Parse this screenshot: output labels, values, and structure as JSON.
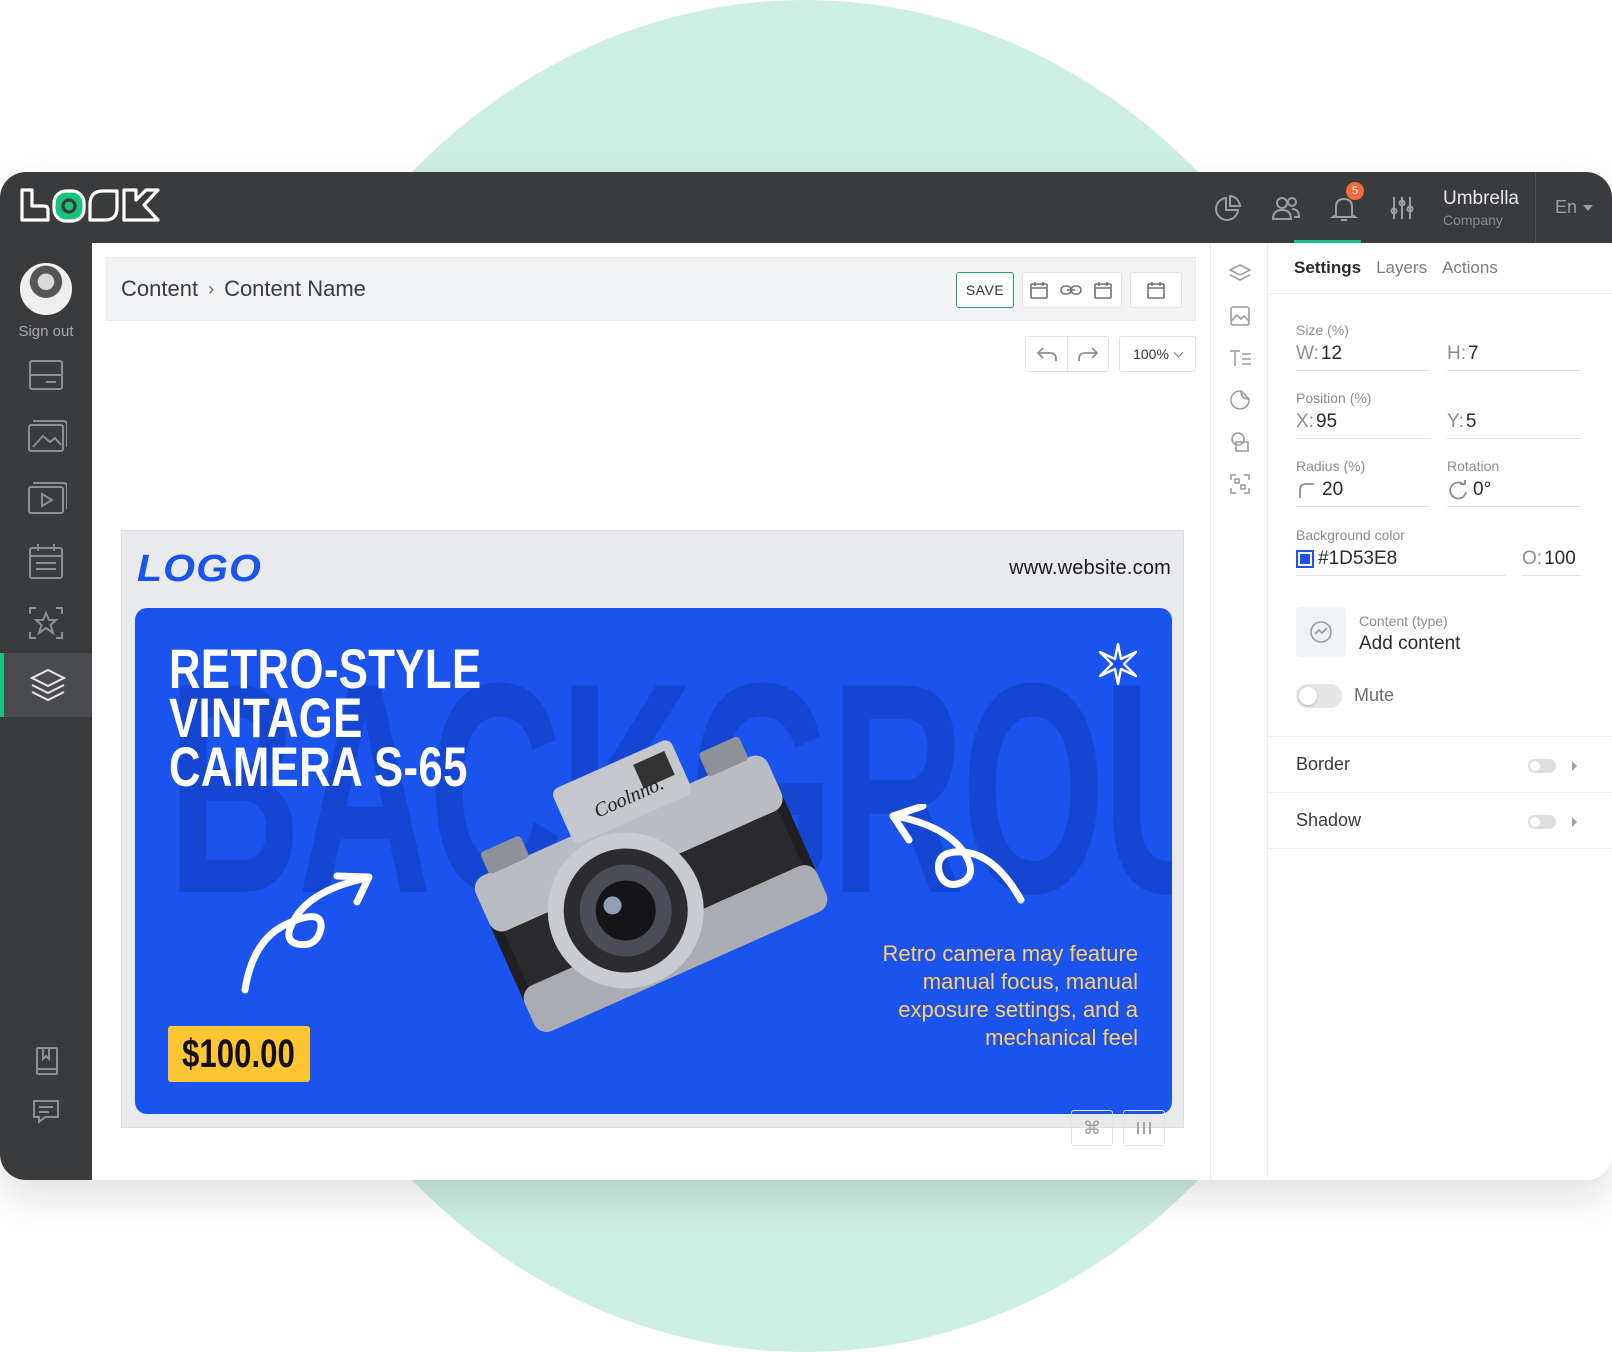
{
  "colors": {
    "accent": "#18c37e",
    "topbar": "#3a3b3d",
    "banner_bg": "#1D53E8",
    "price_bg": "#ffc533",
    "badge": "#f26a3c"
  },
  "app": {
    "logo": "LOOK"
  },
  "topbar": {
    "notifications_count": "5",
    "company_name": "Umbrella",
    "company_sub": "Company",
    "language": "En",
    "icons": [
      "pie-chart-icon",
      "users-icon",
      "bell-icon",
      "sliders-icon"
    ]
  },
  "sidebar": {
    "sign_out": "Sign out",
    "items": [
      "display-icon",
      "image-icon",
      "video-icon",
      "schedule-icon",
      "star-icon",
      "layers-icon",
      "book-icon",
      "chat-icon"
    ],
    "active": "layers-icon"
  },
  "editor": {
    "breadcrumb": {
      "root": "Content",
      "separator": "›",
      "current": "Content Name"
    },
    "save_label": "SAVE",
    "zoom": "100%"
  },
  "banner": {
    "brand_logo": "LOGO",
    "website": "www.website.com",
    "headline": "RETRO-STYLE\nVINTAGE\nCAMERA S-65",
    "background_word": "BACKGROUND",
    "price": "$100.00",
    "description": "Retro camera may feature manual focus, manual exposure settings, and a mechanical feel",
    "camera_brand": "Coolnno."
  },
  "panel": {
    "tabs": [
      "Settings",
      "Layers",
      "Actions"
    ],
    "active_tab": "Settings",
    "size_label": "Size (%)",
    "w_prefix": "W:",
    "w_value": "12",
    "h_prefix": "H:",
    "h_value": "7",
    "position_label": "Position (%)",
    "x_prefix": "X:",
    "x_value": "95",
    "y_prefix": "Y:",
    "y_value": "5",
    "radius_label": "Radius (%)",
    "radius_value": "20",
    "rotation_label": "Rotation",
    "rotation_value": "0°",
    "bg_color_label": "Background color",
    "bg_color_value": "#1D53E8",
    "opacity_prefix": "O:",
    "opacity_value": "100",
    "content_type_label": "Content (type)",
    "content_type_value": "Add content",
    "mute_label": "Mute",
    "mute_on": false,
    "border_label": "Border",
    "border_on": false,
    "shadow_label": "Shadow",
    "shadow_on": false
  }
}
